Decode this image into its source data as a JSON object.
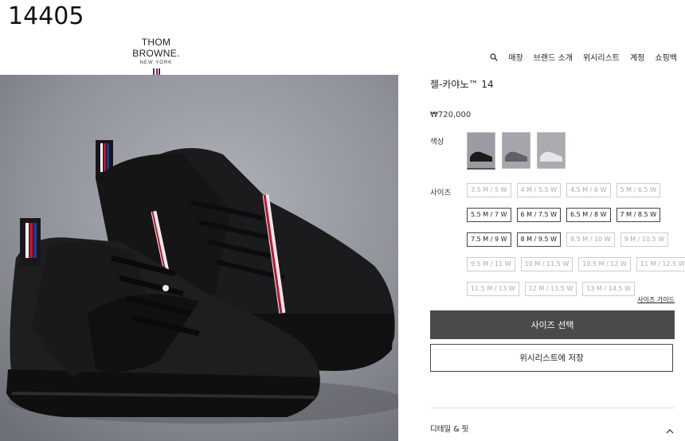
{
  "overlay_number": "14405",
  "logo": {
    "brand": "THOM BROWNE.",
    "city": "NEW YORK"
  },
  "nav": {
    "items": [
      "매장",
      "브랜드 소개",
      "위시리스트",
      "계정",
      "쇼핑백"
    ]
  },
  "product": {
    "title": "젤-카야노™ 14",
    "price": "₩720,000",
    "color_label": "색상",
    "size_label": "사이즈"
  },
  "sizes": [
    [
      {
        "label": "3.5 M / 5 W",
        "available": false
      },
      {
        "label": "4 M / 5.5 W",
        "available": false
      },
      {
        "label": "4.5 M / 6 W",
        "available": false
      },
      {
        "label": "5 M / 6.5 W",
        "available": false
      }
    ],
    [
      {
        "label": "5.5 M / 7 W",
        "available": true
      },
      {
        "label": "6 M / 7.5 W",
        "available": true
      },
      {
        "label": "6.5 M / 8 W",
        "available": true
      },
      {
        "label": "7 M / 8.5 W",
        "available": true
      }
    ],
    [
      {
        "label": "7.5 M / 9 W",
        "available": true
      },
      {
        "label": "8 M / 9.5 W",
        "available": true
      },
      {
        "label": "8.5 M / 10 W",
        "available": false
      },
      {
        "label": "9 M / 10.5 W",
        "available": false
      }
    ],
    [
      {
        "label": "9.5 M / 11 W",
        "available": false
      },
      {
        "label": "10 M / 11.5 W",
        "available": false
      },
      {
        "label": "10.5 M / 12 W",
        "available": false
      },
      {
        "label": "11 M / 12.5 W",
        "available": false
      }
    ],
    [
      {
        "label": "11.5 M / 13 W",
        "available": false
      },
      {
        "label": "12 M / 13.5 W",
        "available": false
      },
      {
        "label": "13 M / 14.5 W",
        "available": false
      }
    ]
  ],
  "size_guide": "사이즈 가이드",
  "buttons": {
    "select_size": "사이즈 선택",
    "save_wishlist": "위시리스트에 저장"
  },
  "details_label": "디테일 & 핏",
  "colors": {
    "primary_button": "#4a4a4a",
    "flag_blue": "#1f3a93",
    "flag_red": "#c8102e"
  },
  "icons": {
    "search": "search-icon",
    "details_toggle": "chevron-up-icon"
  }
}
